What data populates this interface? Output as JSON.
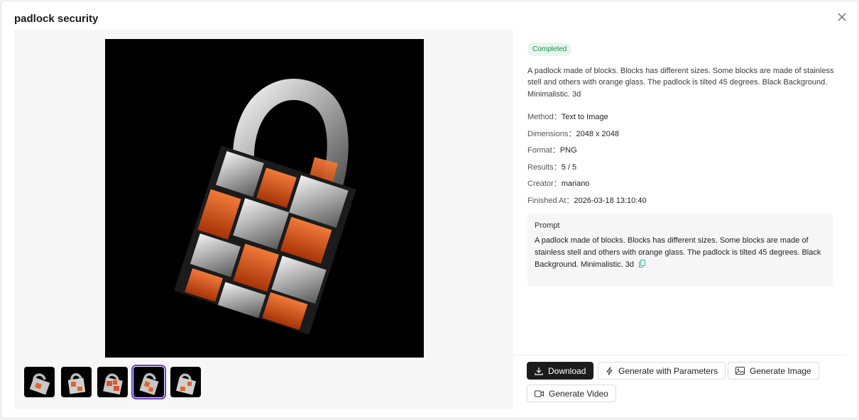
{
  "dialog": {
    "title": "padlock security"
  },
  "status": {
    "label": "Completed"
  },
  "description": "A padlock made of blocks. Blocks has different sizes. Some blocks are made of stainless stell and others with orange glass. The padlock is tilted 45 degrees. Black Background. Minimalistic. 3d",
  "meta": [
    {
      "key": "Method",
      "value": "Text to Image"
    },
    {
      "key": "Dimensions",
      "value": "2048 x 2048"
    },
    {
      "key": "Format",
      "value": "PNG"
    },
    {
      "key": "Results",
      "value": "5 / 5"
    },
    {
      "key": "Creator",
      "value": "mariano"
    },
    {
      "key": "Finished At",
      "value": "2026-03-18 13:10:40"
    }
  ],
  "meta_separator": "：",
  "prompt": {
    "heading": "Prompt",
    "text": "A padlock made of blocks. Blocks has different sizes. Some blocks are made of stainless stell and others with orange glass. The padlock is tilted 45 degrees. Black Background. Minimalistic. 3d"
  },
  "thumbnails": {
    "count": 5,
    "selected_index": 3
  },
  "actions": {
    "download": "Download",
    "generate_with_parameters": "Generate with Parameters",
    "generate_image": "Generate Image",
    "generate_video": "Generate Video"
  },
  "colors": {
    "accent_selected": "#6c3bd6",
    "status_green": "#1d8a50",
    "copy_icon": "#2bb3a3"
  },
  "icons": [
    "close-icon",
    "copy-icon",
    "download-icon",
    "lightning-icon",
    "image-icon",
    "video-icon"
  ]
}
